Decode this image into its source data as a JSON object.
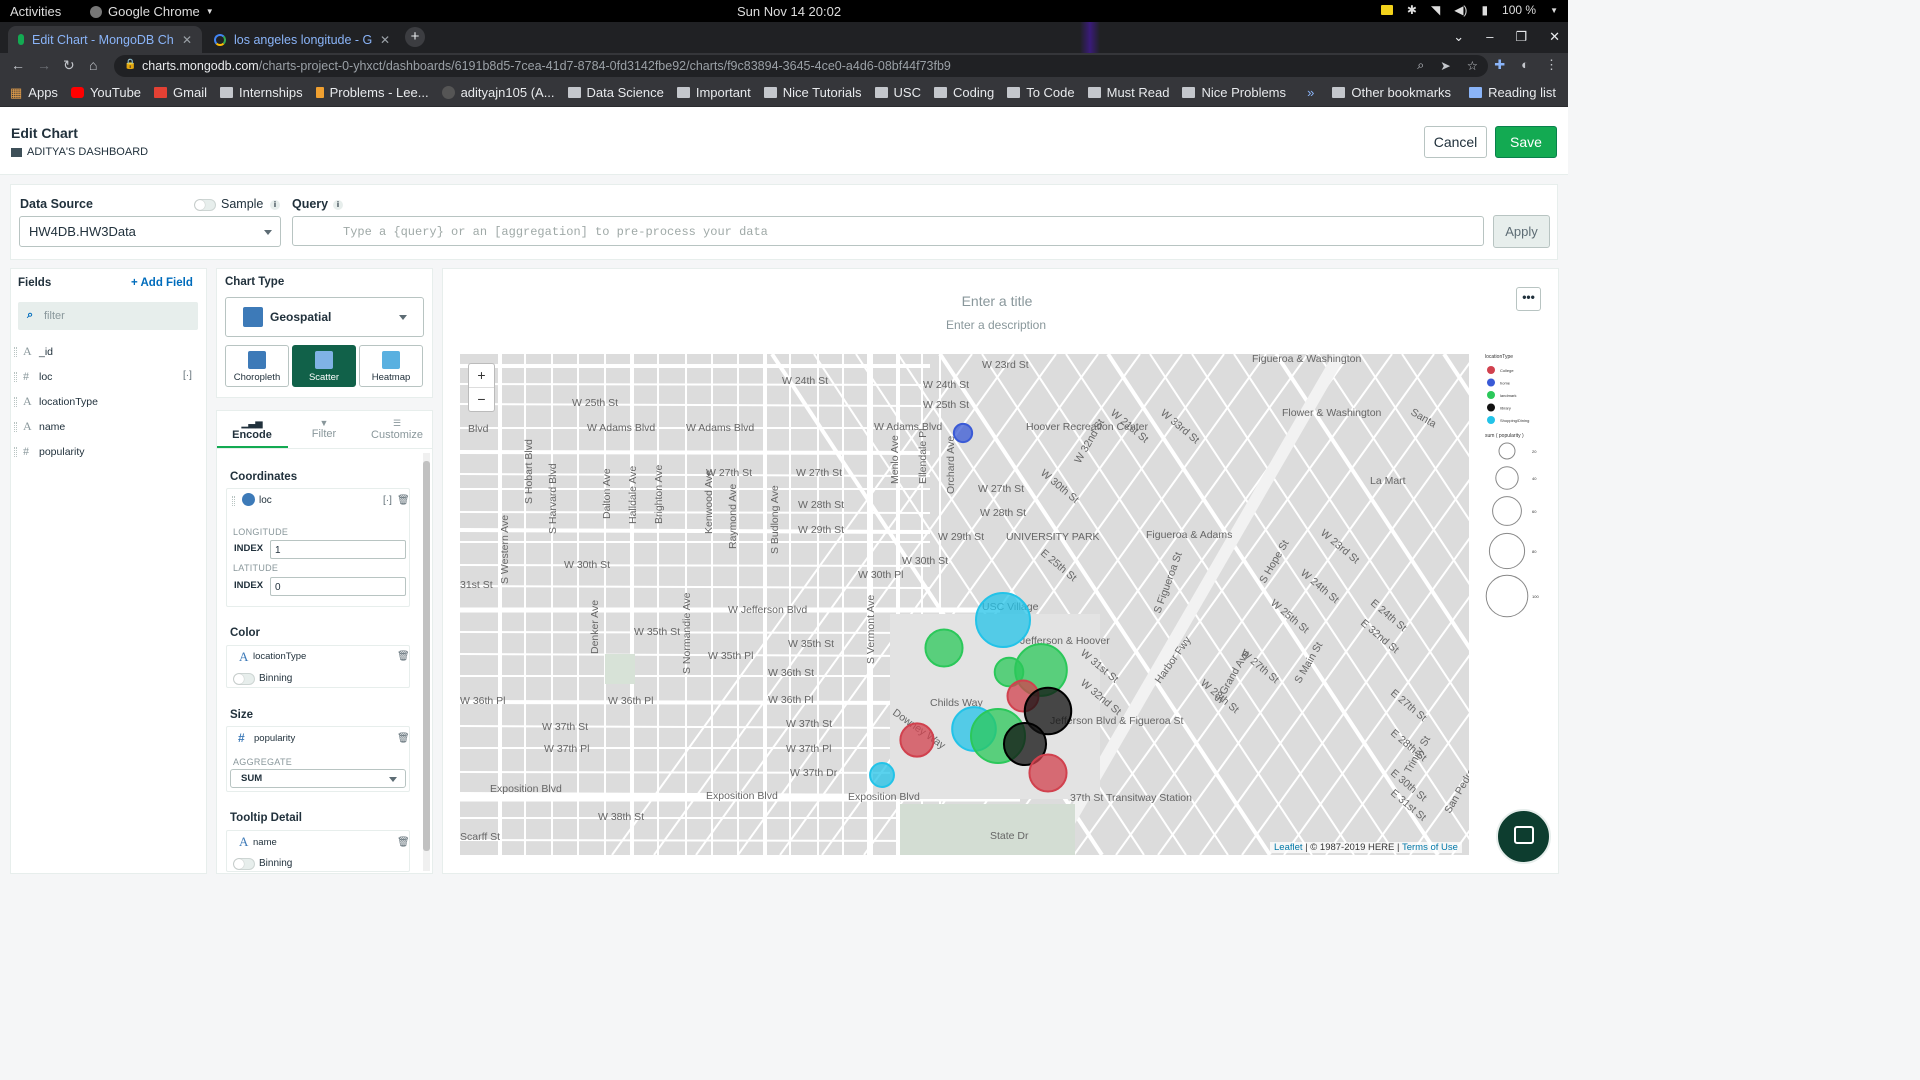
{
  "os": {
    "activities": "Activities",
    "app_name": "Google Chrome",
    "clock": "Sun Nov 14  20:02",
    "battery": "100 %"
  },
  "browser": {
    "tabs": [
      {
        "title": "Edit Chart - MongoDB Ch"
      },
      {
        "title": "los angeles longitude - Go"
      }
    ],
    "url_host": "charts.mongodb.com",
    "url_path": "/charts-project-0-yhxct/dashboards/6191b8d5-7cea-41d7-8784-0fd3142fbe92/charts/f9c83894-3645-4ce0-a4d6-08bf44f73fb9",
    "bookmarks": [
      "Apps",
      "YouTube",
      "Gmail",
      "Internships",
      "Problems - Lee...",
      "adityajn105 (A...",
      "Data Science",
      "Important",
      "Nice Tutorials",
      "USC",
      "Coding",
      "To Code",
      "Must Read",
      "Nice Problems"
    ],
    "bookmarks_right": [
      "Other bookmarks",
      "Reading list"
    ]
  },
  "header": {
    "title": "Edit Chart",
    "dashboard": "ADITYA'S DASHBOARD",
    "cancel": "Cancel",
    "save": "Save"
  },
  "datasource": {
    "label": "Data Source",
    "sample": "Sample",
    "value": "HW4DB.HW3Data",
    "query_label": "Query",
    "query_placeholder": "Type a {query} or an [aggregation] to pre-process your data",
    "apply": "Apply"
  },
  "fields": {
    "title": "Fields",
    "add": "Add Field",
    "filter_placeholder": "filter",
    "items": [
      {
        "name": "_id",
        "type": "A"
      },
      {
        "name": "loc",
        "type": "#"
      },
      {
        "name": "locationType",
        "type": "A"
      },
      {
        "name": "name",
        "type": "A"
      },
      {
        "name": "popularity",
        "type": "#"
      }
    ]
  },
  "chart_type": {
    "label": "Chart Type",
    "selected": "Geospatial",
    "options": [
      "Choropleth",
      "Scatter",
      "Heatmap"
    ],
    "active": "Scatter"
  },
  "encode": {
    "tabs": [
      "Encode",
      "Filter",
      "Customize"
    ],
    "coordinates": {
      "label": "Coordinates",
      "field": "loc",
      "longitude": "LONGITUDE",
      "latitude": "LATITUDE",
      "index_label": "INDEX",
      "lon_index": "1",
      "lat_index": "0"
    },
    "color": {
      "label": "Color",
      "field": "locationType",
      "binning": "Binning"
    },
    "size": {
      "label": "Size",
      "field": "popularity",
      "aggregate_label": "AGGREGATE",
      "aggregate": "SUM"
    },
    "tooltip": {
      "label": "Tooltip Detail",
      "field": "name",
      "binning": "Binning"
    }
  },
  "chart": {
    "title_placeholder": "Enter a title",
    "desc_placeholder": "Enter a description",
    "more": "•••",
    "zoom_in": "+",
    "zoom_out": "−",
    "attribution_leaflet": "Leaflet",
    "attribution_text": " | © 1987-2019 HERE | ",
    "attribution_terms": "Terms of Use",
    "map_labels": [
      "W 23rd St",
      "W 24th St",
      "W 24th St",
      "W 25th St",
      "W 25th St",
      "W Adams Blvd",
      "W Adams Blvd",
      "W Adams Blvd",
      "Blvd",
      "Hoover Recreation Center",
      "W 27th St",
      "W 27th St",
      "W 27th St",
      "W 28th St",
      "W 28th St",
      "W 29th St",
      "W 29th St",
      "W 30th St",
      "W 30th St",
      "W 30th Pl",
      "UNIVERSITY PARK",
      "31st St",
      "W Jefferson Blvd",
      "W 35th St",
      "W 35th St",
      "W 35th Pl",
      "W 36th St",
      "W 36th Pl",
      "W 36th Pl",
      "W 36th Pl",
      "W 37th St",
      "W 37th St",
      "W 37th Pl",
      "W 37th Pl",
      "W 37th Dr",
      "Exposition Blvd",
      "Exposition Blvd",
      "Exposition Blvd",
      "W 38th St",
      "State Dr",
      "37th St Transitway Station",
      "Figueroa & Washington",
      "Flower & Washington",
      "Figueroa & Adams",
      "La Mart",
      "Harbor Fwy",
      "Jefferson & Hoover",
      "Jefferson Blvd & Figueroa St",
      "USC Village",
      "Downey Way",
      "Childs Way",
      "Santa",
      "S Western Ave",
      "S Hobart Blvd",
      "S Harvard Blvd",
      "Dalton Ave",
      "Halldale Ave",
      "Brighton Ave",
      "Kenwood Ave",
      "Raymond Ave",
      "S Budlong Ave",
      "Menlo Ave",
      "Ellendale Pl",
      "Orchard Ave",
      "S Normandie Ave",
      "S Vermont Ave",
      "Denker Ave",
      "S Figueroa St",
      "S Grand Ave",
      "S Hope St",
      "S Main St",
      "Trinity St",
      "San Pedro St",
      "E 24th St",
      "E 27th St",
      "E 28th St",
      "E 30th St",
      "E 31st St",
      "E 32nd St",
      "E 25th St",
      "W 31st St",
      "W 32nd St",
      "W 33rd St",
      "W 21st St",
      "W 23rd St",
      "W 24th St",
      "W 25th St",
      "W 27th St",
      "W 28th St",
      "W 30th St",
      "W 32nd St",
      "Scarff St",
      "Pl"
    ],
    "legend": {
      "color_title": "locationType",
      "color_items": [
        {
          "label": "College",
          "color": "#d1414e"
        },
        {
          "label": "home",
          "color": "#3a5ad6"
        },
        {
          "label": "landmark",
          "color": "#2bc85a"
        },
        {
          "label": "library",
          "color": "#111111"
        },
        {
          "label": "Shopping/Dining",
          "color": "#23c3e8"
        }
      ],
      "size_title": "sum ( popularity )",
      "size_items": [
        "20",
        "40",
        "60",
        "80",
        "100"
      ]
    }
  },
  "chart_data": {
    "type": "scatter",
    "title": "",
    "color_field": "locationType",
    "size_field": "sum ( popularity )",
    "points": [
      {
        "locationType": "Shopping/Dining",
        "popularity": 100
      },
      {
        "locationType": "landmark",
        "popularity": 40
      },
      {
        "locationType": "landmark",
        "popularity": 20
      },
      {
        "locationType": "landmark",
        "popularity": 90
      },
      {
        "locationType": "College",
        "popularity": 25
      },
      {
        "locationType": "library",
        "popularity": 70
      },
      {
        "locationType": "College",
        "popularity": 30
      },
      {
        "locationType": "Shopping/Dining",
        "popularity": 60
      },
      {
        "locationType": "landmark",
        "popularity": 100
      },
      {
        "locationType": "library",
        "popularity": 55
      },
      {
        "locationType": "College",
        "popularity": 40
      },
      {
        "locationType": "Shopping/Dining",
        "popularity": 12
      },
      {
        "locationType": "home",
        "popularity": 5
      }
    ]
  }
}
